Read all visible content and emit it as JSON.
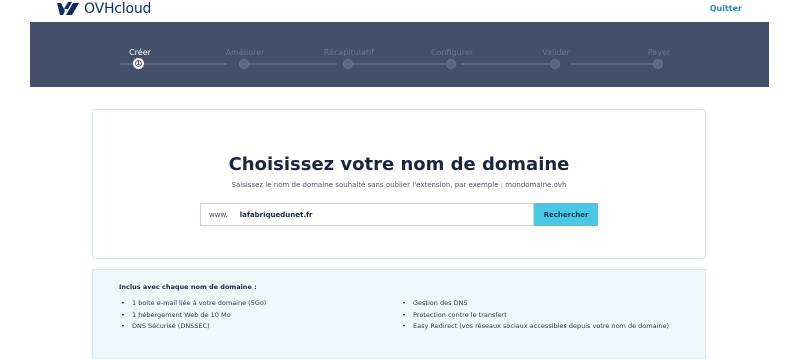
{
  "header": {
    "logo_text": "OVHcloud",
    "quit_label": "Quitter"
  },
  "stepper": {
    "steps": [
      {
        "label": "Créer",
        "active": true,
        "number": "1"
      },
      {
        "label": "Améliorer",
        "active": false
      },
      {
        "label": "Récapitulatif",
        "active": false
      },
      {
        "label": "Configurer",
        "active": false
      },
      {
        "label": "Valider",
        "active": false
      },
      {
        "label": "Payer",
        "active": false
      }
    ]
  },
  "main": {
    "title": "Choisissez votre nom de domaine",
    "subtitle": "Saisissez le nom de domaine souhaité sans oublier l'extension, par exemple : mondomaine.ovh",
    "search": {
      "prefix": "www.",
      "value": "lafabriquedunet.fr",
      "button_label": "Rechercher"
    }
  },
  "info": {
    "title": "Inclus avec chaque nom de domaine :",
    "left_items": [
      "1 boite e-mail liée à votre domaine (5Go)",
      "1 hébergement Web de 10 Mo",
      "DNS Sécurisé (DNSSEC)"
    ],
    "right_items": [
      "Gestion des DNS",
      "Protection contre le transfert",
      "Easy Redirect (vos réseaux sociaux accessibles depuis votre nom de domaine)"
    ]
  },
  "colors": {
    "stepper_bg": "#44506a",
    "accent_button": "#4bc7e6",
    "logo_blue": "#0b2b6b",
    "info_bg": "#eef8fb"
  }
}
